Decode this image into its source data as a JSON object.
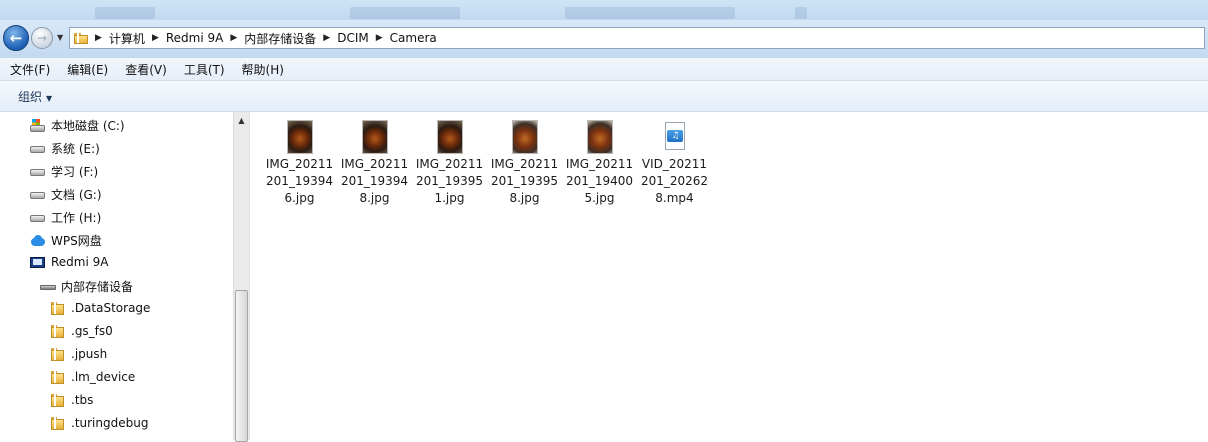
{
  "breadcrumb": [
    "计算机",
    "Redmi 9A",
    "内部存储设备",
    "DCIM",
    "Camera"
  ],
  "menu": [
    "文件(F)",
    "编辑(E)",
    "查看(V)",
    "工具(T)",
    "帮助(H)"
  ],
  "toolbar": {
    "organize_label": "组织"
  },
  "nav_tree": [
    {
      "label": "本地磁盘 (C:)",
      "icon": "system-drive-icon"
    },
    {
      "label": "系统 (E:)",
      "icon": "drive-icon"
    },
    {
      "label": "学习 (F:)",
      "icon": "drive-icon"
    },
    {
      "label": "文档 (G:)",
      "icon": "drive-icon"
    },
    {
      "label": "工作 (H:)",
      "icon": "drive-icon"
    },
    {
      "label": "WPS网盘",
      "icon": "cloud-icon"
    },
    {
      "label": "Redmi 9A",
      "icon": "phone-icon"
    },
    {
      "label": "内部存储设备",
      "icon": "storage-icon"
    },
    {
      "label": ".DataStorage",
      "icon": "folder-icon"
    },
    {
      "label": ".gs_fs0",
      "icon": "folder-icon"
    },
    {
      "label": ".jpush",
      "icon": "folder-icon"
    },
    {
      "label": ".lm_device",
      "icon": "folder-icon"
    },
    {
      "label": ".tbs",
      "icon": "folder-icon"
    },
    {
      "label": ".turingdebug",
      "icon": "folder-icon"
    }
  ],
  "files": [
    {
      "name": "IMG_20211201_193946.jpg",
      "type": "image"
    },
    {
      "name": "IMG_20211201_193948.jpg",
      "type": "image"
    },
    {
      "name": "IMG_20211201_193951.jpg",
      "type": "image"
    },
    {
      "name": "IMG_20211201_193958.jpg",
      "type": "image"
    },
    {
      "name": "IMG_20211201_194005.jpg",
      "type": "image"
    },
    {
      "name": "VID_20211201_202628.mp4",
      "type": "video"
    }
  ]
}
